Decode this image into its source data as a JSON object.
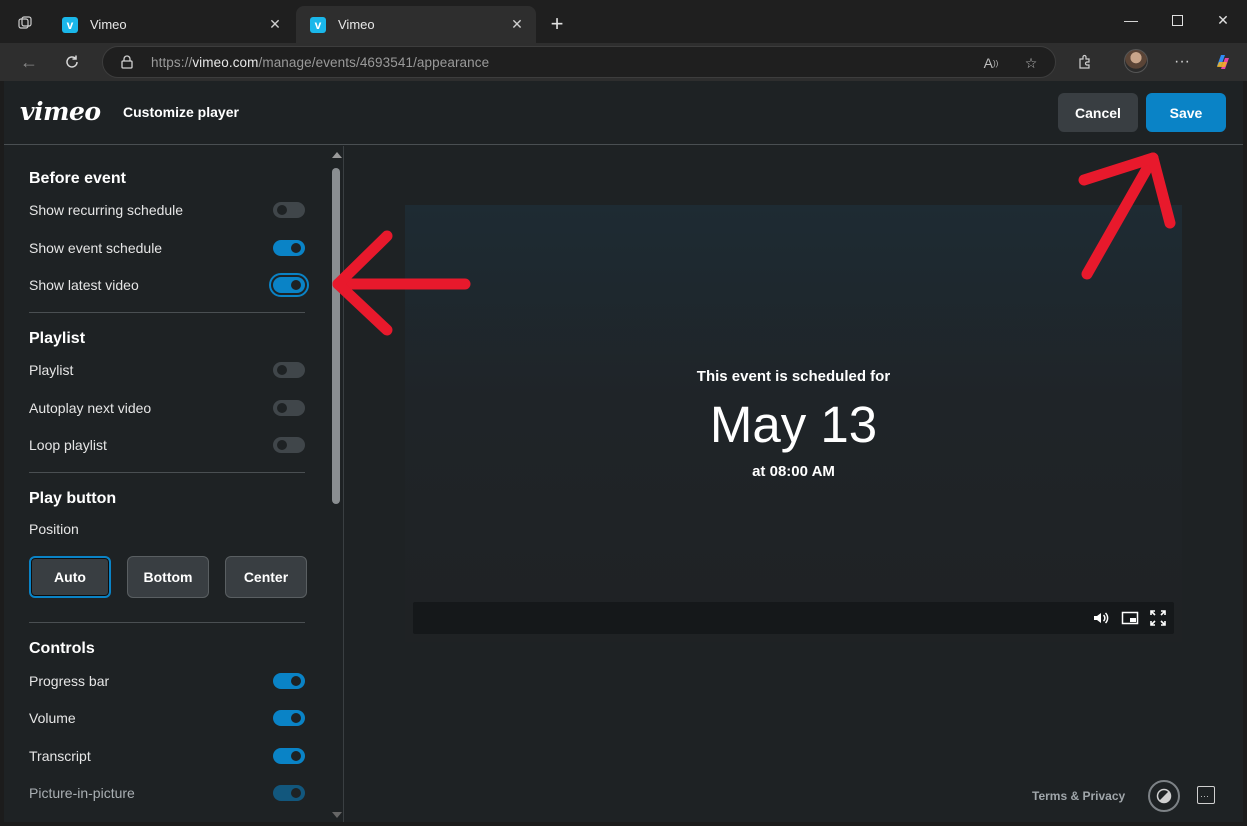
{
  "browser": {
    "tabs": [
      {
        "title": "Vimeo",
        "favicon": "v"
      },
      {
        "title": "Vimeo",
        "favicon": "v"
      }
    ],
    "url_scheme": "https://",
    "url_host": "vimeo.com",
    "url_path": "/manage/events/4693541/appearance"
  },
  "header": {
    "logo": "vimeo",
    "title": "Customize player",
    "cancel_label": "Cancel",
    "save_label": "Save"
  },
  "sidebar": {
    "before_event": {
      "title": "Before event",
      "items": [
        {
          "label": "Show recurring schedule",
          "on": false
        },
        {
          "label": "Show event schedule",
          "on": true
        },
        {
          "label": "Show latest video",
          "on": true
        }
      ]
    },
    "playlist": {
      "title": "Playlist",
      "items": [
        {
          "label": "Playlist",
          "on": false
        },
        {
          "label": "Autoplay next video",
          "on": false
        },
        {
          "label": "Loop playlist",
          "on": false
        }
      ]
    },
    "play_button": {
      "title": "Play button",
      "position_label": "Position",
      "options": [
        "Auto",
        "Bottom",
        "Center"
      ],
      "selected": "Auto"
    },
    "controls": {
      "title": "Controls",
      "items": [
        {
          "label": "Progress bar",
          "on": true
        },
        {
          "label": "Volume",
          "on": true
        },
        {
          "label": "Transcript",
          "on": true
        },
        {
          "label": "Picture-in-picture",
          "on": true
        }
      ]
    }
  },
  "preview": {
    "scheduled_prefix": "This event is scheduled for",
    "date": "May 13",
    "time": "at 08:00 AM"
  },
  "footer": {
    "terms_label": "Terms & Privacy"
  },
  "colors": {
    "accent": "#0a83c6",
    "annotation_arrow": "#e8192c"
  }
}
